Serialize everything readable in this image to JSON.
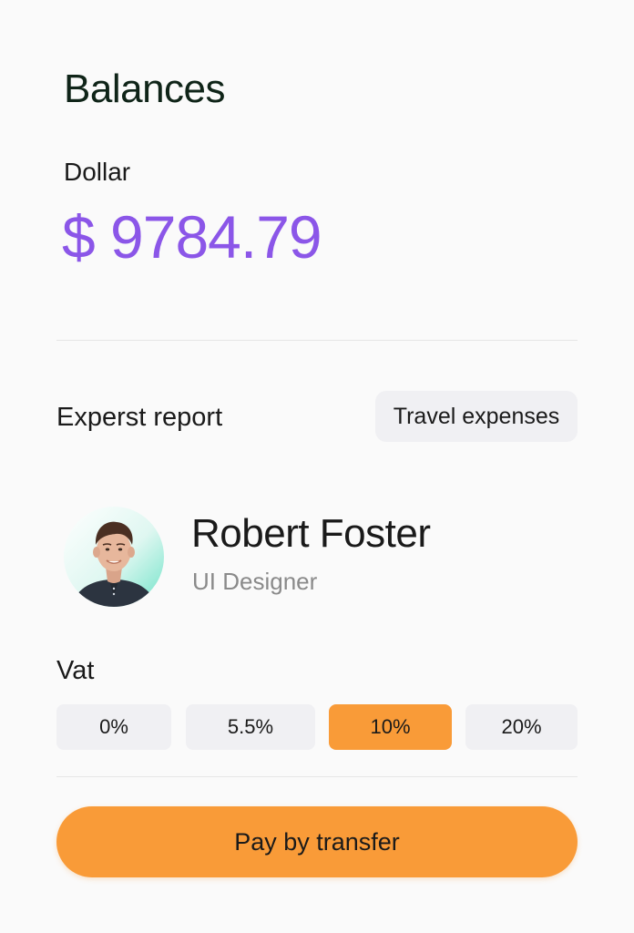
{
  "balances": {
    "title": "Balances",
    "currency_label": "Dollar",
    "amount": "$ 9784.79"
  },
  "report": {
    "label": "Experst report",
    "category": "Travel expenses"
  },
  "person": {
    "name": "Robert Foster",
    "role": "UI Designer"
  },
  "vat": {
    "label": "Vat",
    "options": [
      "0%",
      "5.5%",
      "10%",
      "20%"
    ],
    "selected": "10%"
  },
  "actions": {
    "pay_label": "Pay by transfer"
  },
  "colors": {
    "accent": "#f99b38",
    "amount": "#8b56e8",
    "chip_bg": "#f0f0f3"
  }
}
